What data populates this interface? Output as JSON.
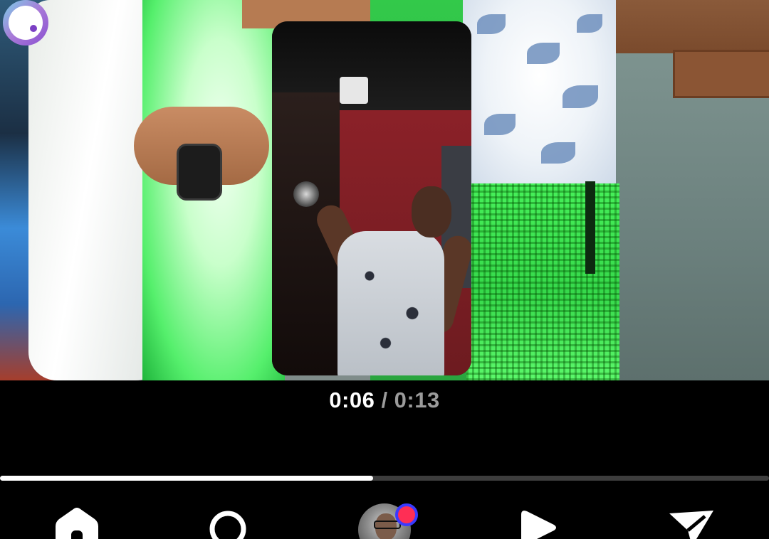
{
  "player": {
    "current_time": "0:06",
    "separator": " / ",
    "total_time": "0:13",
    "progress_fraction": 0.485
  },
  "nav": {
    "items": [
      {
        "icon": "home-icon"
      },
      {
        "icon": "search-icon"
      },
      {
        "icon": "profile-avatar",
        "badge": "notification-dot"
      },
      {
        "icon": "play-icon"
      },
      {
        "icon": "send-icon"
      }
    ]
  },
  "colors": {
    "background": "#000000",
    "progress_fill": "#ffffff",
    "progress_track": "#3d3d3d",
    "notification_dot": "#ff2e55"
  }
}
